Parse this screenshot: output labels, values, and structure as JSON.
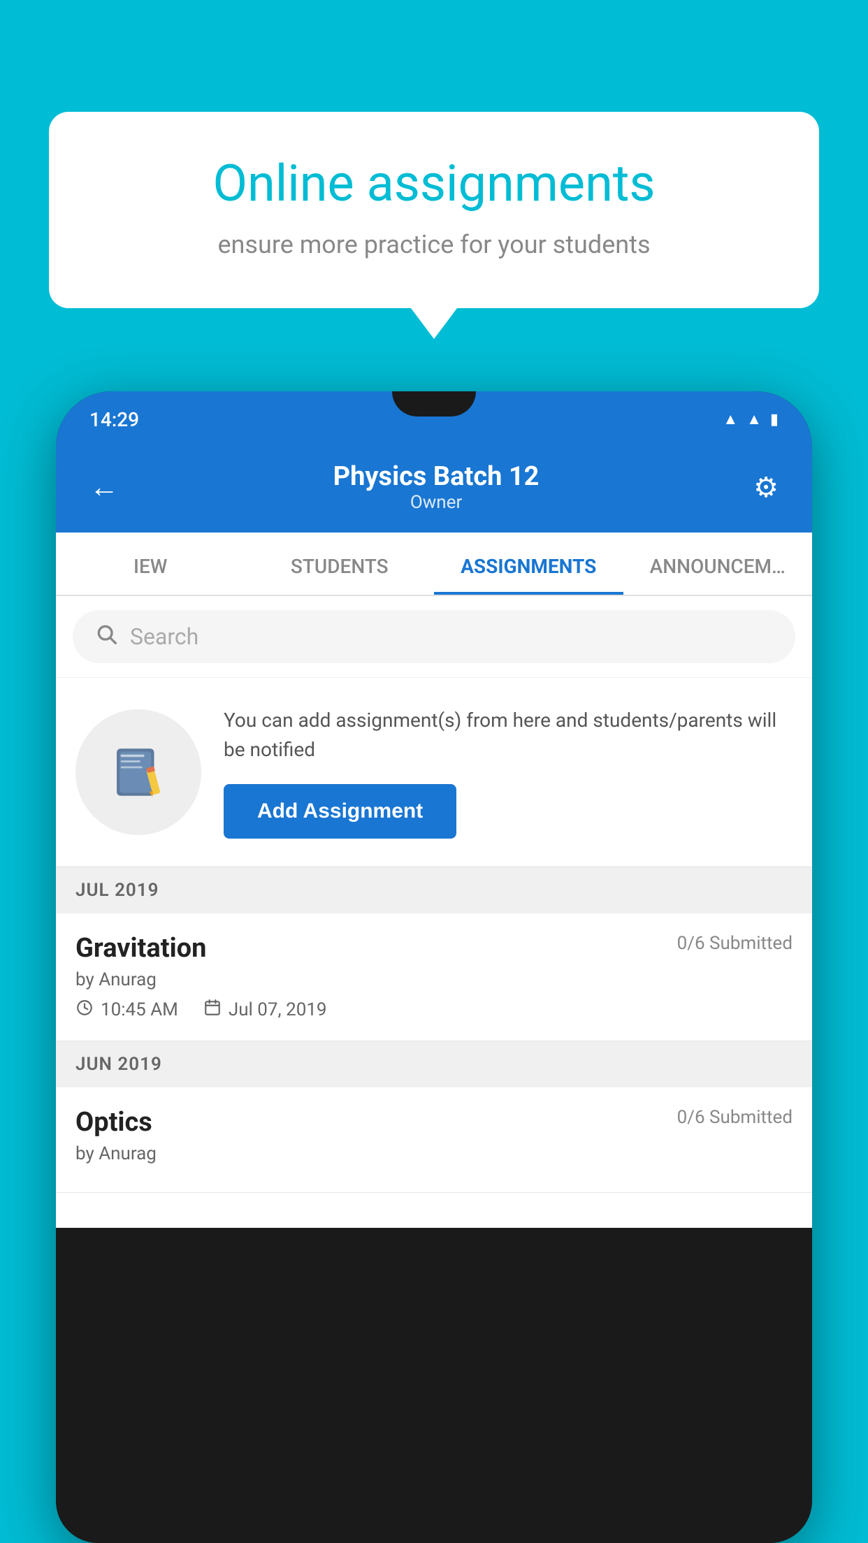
{
  "background_color": "#00bcd4",
  "speech_bubble": {
    "title": "Online assignments",
    "subtitle": "ensure more practice for your students"
  },
  "phone": {
    "status_bar": {
      "time": "14:29",
      "icons": [
        "wifi",
        "signal",
        "battery"
      ]
    },
    "header": {
      "title": "Physics Batch 12",
      "subtitle": "Owner",
      "back_label": "←",
      "settings_label": "⚙"
    },
    "tabs": [
      {
        "label": "IEW",
        "active": false
      },
      {
        "label": "STUDENTS",
        "active": false
      },
      {
        "label": "ASSIGNMENTS",
        "active": true
      },
      {
        "label": "ANNOUNCEM…",
        "active": false
      }
    ],
    "search": {
      "placeholder": "Search"
    },
    "promo": {
      "description": "You can add assignment(s) from here and students/parents will be notified",
      "button_label": "Add Assignment"
    },
    "sections": [
      {
        "label": "JUL 2019",
        "assignments": [
          {
            "title": "Gravitation",
            "submitted": "0/6 Submitted",
            "author": "by Anurag",
            "time": "10:45 AM",
            "date": "Jul 07, 2019"
          }
        ]
      },
      {
        "label": "JUN 2019",
        "assignments": [
          {
            "title": "Optics",
            "submitted": "0/6 Submitted",
            "author": "by Anurag",
            "time": "",
            "date": ""
          }
        ]
      }
    ]
  }
}
